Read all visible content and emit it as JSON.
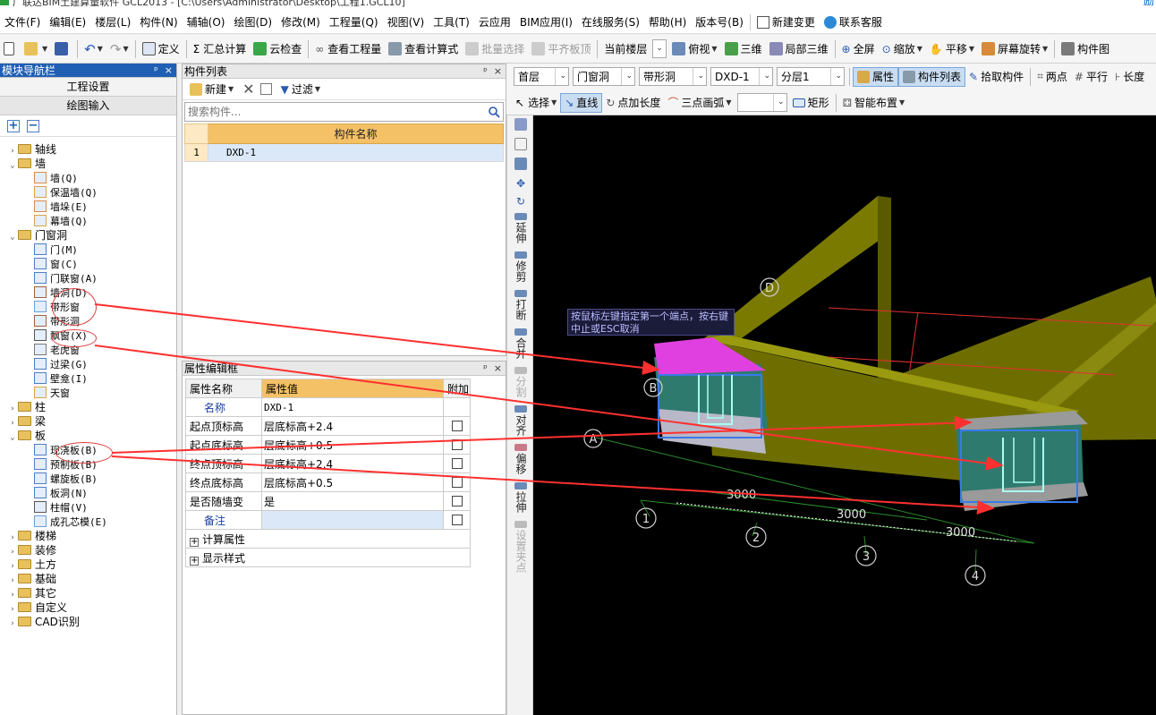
{
  "titlebar": {
    "text": "广联达BIM土建算量软件 GCL2013 - [C:\\Users\\Administrator\\Desktop\\工程1.GCL10]",
    "right": "励"
  },
  "menu": {
    "items": [
      "文件(F)",
      "编辑(E)",
      "楼层(L)",
      "构件(N)",
      "辅轴(O)",
      "绘图(D)",
      "修改(M)",
      "工程量(Q)",
      "视图(V)",
      "工具(T)",
      "云应用",
      "BIM应用(I)",
      "在线服务(S)",
      "帮助(H)",
      "版本号(B)"
    ],
    "new_change": "新建变更",
    "support": "联系客服"
  },
  "toolbar1": {
    "define": "定义",
    "sum_calc": "汇总计算",
    "cloud_check": "云检查",
    "view_qty": "查看工程量",
    "view_formula": "查看计算式",
    "batch_select": "批量选择",
    "align_slab": "平齐板顶",
    "current_floor": "当前楼层",
    "top_view": "俯视",
    "three_d": "三维",
    "local_3d": "局部三维",
    "fullscreen": "全屏",
    "zoom": "缩放",
    "pan": "平移",
    "screen_rotate": "屏幕旋转",
    "comp_pick": "构件图"
  },
  "nav": {
    "title": "模块导航栏",
    "project_settings": "工程设置",
    "drawing_input": "绘图输入",
    "tree": [
      {
        "label": "轴线",
        "level": 0,
        "exp": "›"
      },
      {
        "label": "墙",
        "level": 0,
        "exp": "⌄",
        "open": true
      },
      {
        "label": "墙(Q)",
        "level": 1,
        "color": "#d98a4a"
      },
      {
        "label": "保温墙(Q)",
        "level": 1,
        "color": "#d9a44a"
      },
      {
        "label": "墙垛(E)",
        "level": 1,
        "color": "#d98a4a"
      },
      {
        "label": "幕墙(Q)",
        "level": 1,
        "color": "#d9a44a"
      },
      {
        "label": "门窗洞",
        "level": 0,
        "exp": "⌄",
        "open": true
      },
      {
        "label": "门(M)",
        "level": 1,
        "color": "#4a7ec8"
      },
      {
        "label": "窗(C)",
        "level": 1,
        "color": "#4a7ec8"
      },
      {
        "label": "门联窗(A)",
        "level": 1,
        "color": "#4a7ec8"
      },
      {
        "label": "墙洞(D)",
        "level": 1,
        "color": "#a06040"
      },
      {
        "label": "带形窗",
        "level": 1,
        "color": "#6aa0d8"
      },
      {
        "label": "带形洞",
        "level": 1,
        "color": "#a06040"
      },
      {
        "label": "飘窗(X)",
        "level": 1,
        "color": "#555555"
      },
      {
        "label": "老虎窗",
        "level": 1,
        "color": "#777777"
      },
      {
        "label": "过梁(G)",
        "level": 1,
        "color": "#4a7ec8"
      },
      {
        "label": "壁龛(I)",
        "level": 1,
        "color": "#4a7ec8"
      },
      {
        "label": "天窗",
        "level": 1,
        "color": "#d9a44a"
      },
      {
        "label": "柱",
        "level": 0,
        "exp": "›"
      },
      {
        "label": "梁",
        "level": 0,
        "exp": "›"
      },
      {
        "label": "板",
        "level": 0,
        "exp": "⌄",
        "open": true
      },
      {
        "label": "现浇板(B)",
        "level": 1,
        "color": "#4a7ec8"
      },
      {
        "label": "预制板(B)",
        "level": 1,
        "color": "#4a7ec8"
      },
      {
        "label": "螺旋板(B)",
        "level": 1,
        "color": "#4a7ec8"
      },
      {
        "label": "板洞(N)",
        "level": 1,
        "color": "#4a7ec8"
      },
      {
        "label": "柱帽(V)",
        "level": 1,
        "color": "#555555"
      },
      {
        "label": "成孔芯模(E)",
        "level": 1,
        "color": "#6aa0d8"
      },
      {
        "label": "楼梯",
        "level": 0,
        "exp": "›"
      },
      {
        "label": "装修",
        "level": 0,
        "exp": "›"
      },
      {
        "label": "土方",
        "level": 0,
        "exp": "›"
      },
      {
        "label": "基础",
        "level": 0,
        "exp": "›"
      },
      {
        "label": "其它",
        "level": 0,
        "exp": "›"
      },
      {
        "label": "自定义",
        "level": 0,
        "exp": "›"
      },
      {
        "label": "CAD识别",
        "level": 0,
        "exp": "›"
      }
    ]
  },
  "complist": {
    "title": "构件列表",
    "new": "新建",
    "filter": "过滤",
    "search_placeholder": "搜索构件...",
    "col_name": "构件名称",
    "rows": [
      {
        "num": "1",
        "name": "DXD-1"
      }
    ]
  },
  "propedit": {
    "title": "属性编辑框",
    "h_name": "属性名称",
    "h_value": "属性值",
    "h_extra": "附加",
    "rows": [
      {
        "k": "名称",
        "v": "DXD-1",
        "blue": true,
        "cb": false
      },
      {
        "k": "起点顶标高",
        "v": "层底标高+2.4",
        "cb": true
      },
      {
        "k": "起点底标高",
        "v": "层底标高+0.5",
        "cb": true
      },
      {
        "k": "终点顶标高",
        "v": "层底标高+2.4",
        "cb": true
      },
      {
        "k": "终点底标高",
        "v": "层底标高+0.5",
        "cb": true
      },
      {
        "k": "是否随墙变",
        "v": "是",
        "cb": true
      },
      {
        "k": "备注",
        "v": "",
        "blue": true,
        "cb": true
      }
    ],
    "group1": "计算属性",
    "group2": "显示样式"
  },
  "drawtb": {
    "floor": "首层",
    "type": "门窗洞",
    "sub": "带形洞",
    "comp": "DXD-1",
    "layer": "分层1",
    "prop": "属性",
    "complist": "构件列表",
    "pick": "拾取构件",
    "twopt": "两点",
    "parallel": "平行",
    "length": "长度",
    "select": "选择",
    "line": "直线",
    "add_len": "点加长度",
    "arc": "三点画弧",
    "rect": "矩形",
    "smart": "智能布置"
  },
  "vtools": {
    "extend": "延伸",
    "trim": "修剪",
    "break": "打断",
    "merge": "合并",
    "split": "分割",
    "align": "对齐",
    "offset": "偏移",
    "stretch": "拉伸",
    "grip": "设置夹点"
  },
  "canvas": {
    "tip": "按鼠标左键指定第一个端点，按右键中止或ESC取消",
    "dims": [
      "3000",
      "3000",
      "3000"
    ],
    "axes_num": [
      "1",
      "2",
      "3",
      "4"
    ],
    "axes_let": [
      "A",
      "B",
      "D"
    ]
  },
  "colors": {
    "wall": "#7a7a00",
    "wall_top": "#9a9a10",
    "accent_magenta": "#e040e0",
    "arrow": "#ff3030",
    "nav_title": "#1f5fb4",
    "header": "#f5c167"
  }
}
